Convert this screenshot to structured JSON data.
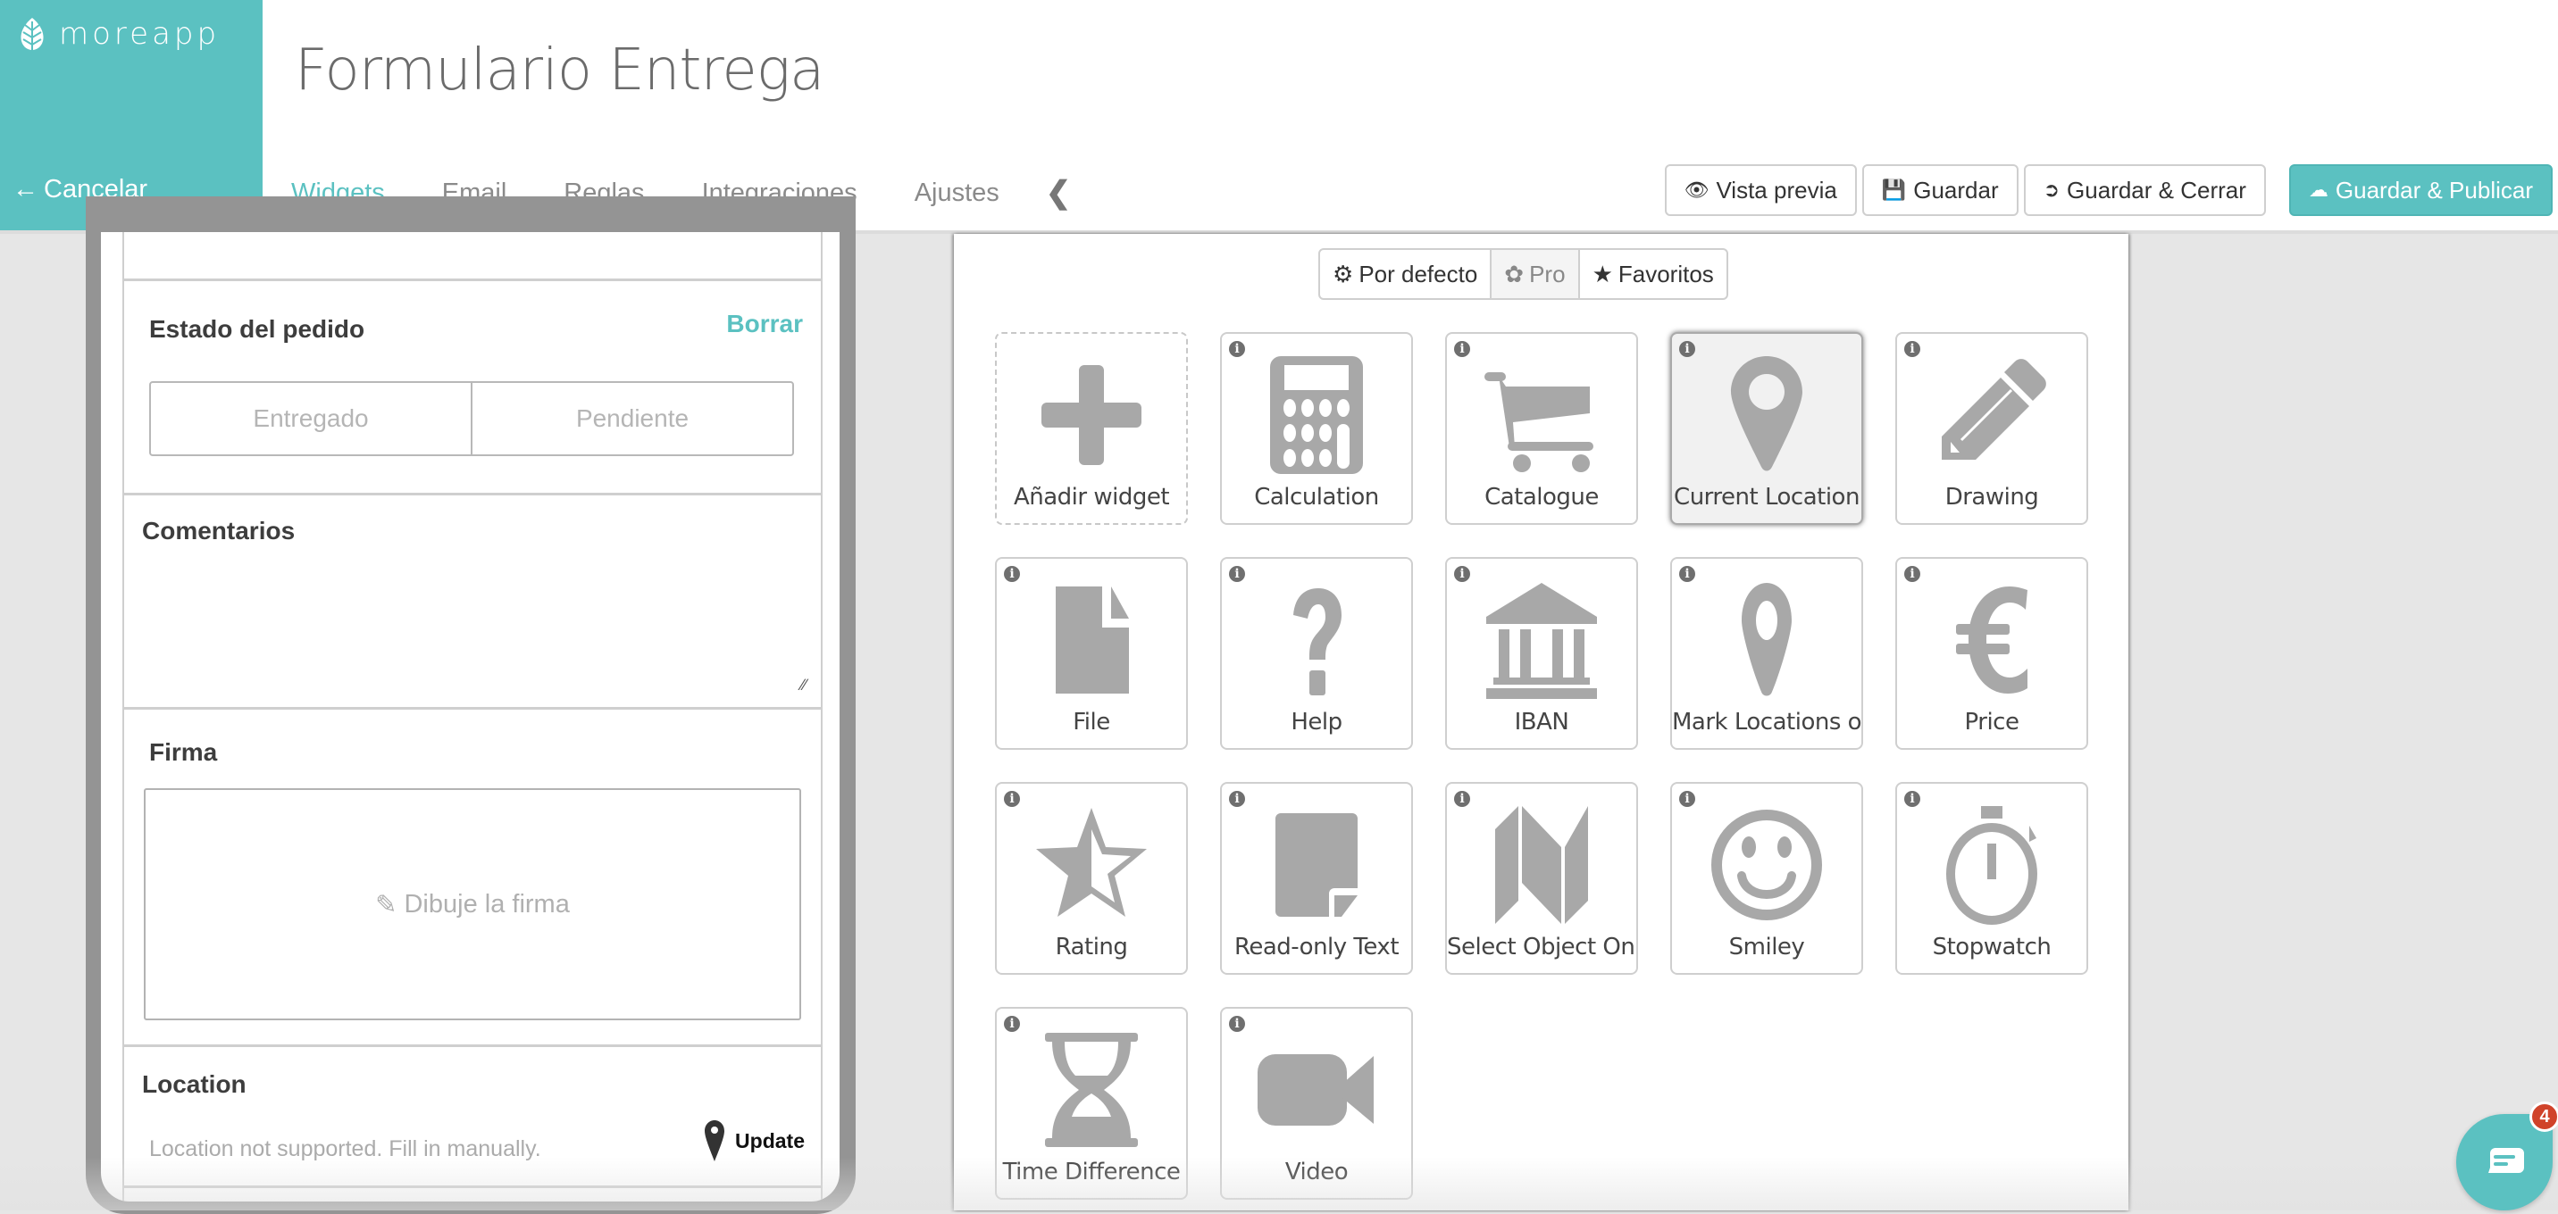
{
  "brand": {
    "name": "moreapp",
    "color": "#5bc1c1",
    "icon": "leaf-icon"
  },
  "header": {
    "cancel_label": "Cancelar",
    "title": "Formulario Entrega",
    "tabs": [
      {
        "label": "Widgets",
        "active": true
      },
      {
        "label": "Email",
        "active": false
      },
      {
        "label": "Reglas",
        "active": false
      },
      {
        "label": "Integraciones",
        "active": false
      },
      {
        "label": "Ajustes",
        "active": false
      }
    ],
    "collapse_icon": "chevron-left-icon",
    "actions": [
      {
        "label": "Vista previa",
        "icon": "eye-icon"
      },
      {
        "label": "Guardar",
        "icon": "floppy-disk-icon"
      },
      {
        "label": "Guardar & Cerrar",
        "icon": "sign-out-icon"
      },
      {
        "label": "Guardar & Publicar",
        "icon": "cloud-upload-icon"
      }
    ]
  },
  "preview": {
    "order_status": {
      "label": "Estado del pedido",
      "clear_label": "Borrar",
      "options": [
        "Entregado",
        "Pendiente"
      ]
    },
    "comments": {
      "label": "Comentarios",
      "value": ""
    },
    "signature": {
      "label": "Firma",
      "placeholder": "Dibuje la firma"
    },
    "location": {
      "label": "Location",
      "message": "Location not supported. Fill in manually.",
      "update_label": "Update"
    }
  },
  "palette": {
    "filters": [
      {
        "label": "Por defecto",
        "icon": "dashboard-icon"
      },
      {
        "label": "Pro",
        "icon": "leaf-icon"
      },
      {
        "label": "Favoritos",
        "icon": "star-icon"
      }
    ],
    "widgets": [
      {
        "label": "Añadir widget",
        "icon": "plus-icon"
      },
      {
        "label": "Calculation",
        "icon": "calculator-icon"
      },
      {
        "label": "Catalogue",
        "icon": "shopping-cart-icon"
      },
      {
        "label": "Current Location",
        "icon": "map-marker-icon"
      },
      {
        "label": "Drawing",
        "icon": "pencil-icon"
      },
      {
        "label": "File",
        "icon": "file-icon"
      },
      {
        "label": "Help",
        "icon": "question-icon"
      },
      {
        "label": "IBAN",
        "icon": "bank-icon"
      },
      {
        "label": "Mark Locations o...",
        "icon": "map-marker-icon"
      },
      {
        "label": "Price",
        "icon": "euro-icon"
      },
      {
        "label": "Rating",
        "icon": "star-half-icon"
      },
      {
        "label": "Read-only Text",
        "icon": "sticky-note-icon"
      },
      {
        "label": "Select Object On ...",
        "icon": "map-icon"
      },
      {
        "label": "Smiley",
        "icon": "smiley-icon"
      },
      {
        "label": "Stopwatch",
        "icon": "stopwatch-icon"
      },
      {
        "label": "Time Difference",
        "icon": "hourglass-icon"
      },
      {
        "label": "Video",
        "icon": "video-camera-icon"
      }
    ]
  },
  "chat": {
    "badge_count": "4"
  }
}
